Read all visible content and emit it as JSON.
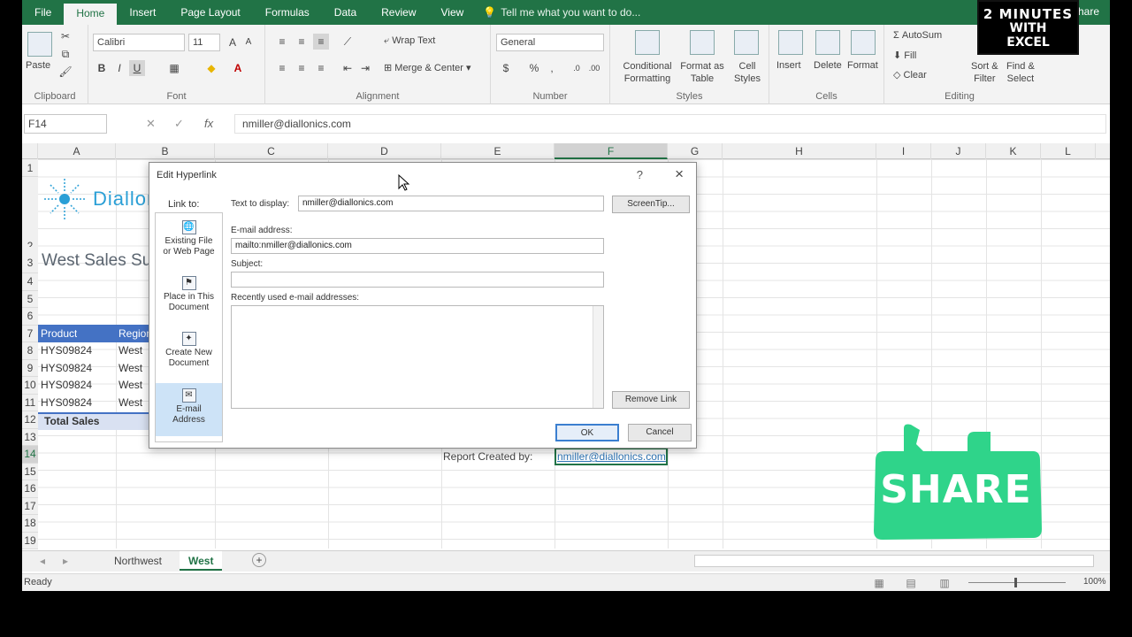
{
  "ribbon": {
    "tabs": [
      "File",
      "Home",
      "Insert",
      "Page Layout",
      "Formulas",
      "Data",
      "Review",
      "View"
    ],
    "active_tab": "Home",
    "tell_me": "Tell me what you want to do...",
    "share": "Share",
    "clipboard": {
      "paste": "Paste",
      "label": "Clipboard"
    },
    "font": {
      "name": "Calibri",
      "size": "11",
      "bold": "B",
      "italic": "I",
      "underline": "U",
      "label": "Font"
    },
    "alignment": {
      "wrap_text": "Wrap Text",
      "merge_center": "Merge & Center",
      "label": "Alignment"
    },
    "number": {
      "format": "General",
      "currency": "$",
      "percent": "%",
      "comma": ",",
      "label": "Number"
    },
    "styles": {
      "conditional": [
        "Conditional",
        "Formatting"
      ],
      "format_as": [
        "Format as",
        "Table"
      ],
      "cell_styles": [
        "Cell",
        "Styles"
      ],
      "label": "Styles"
    },
    "cells": {
      "insert": "Insert",
      "delete": "Delete",
      "format": "Format",
      "label": "Cells"
    },
    "editing": {
      "autosum": "AutoSum",
      "fill": "Fill",
      "clear": "Clear",
      "sort_filter": [
        "Sort &",
        "Filter"
      ],
      "find_select": [
        "Find &",
        "Select"
      ],
      "label": "Editing"
    }
  },
  "formula_bar": {
    "name_box": "F14",
    "fx": "fx",
    "content": "nmiller@diallonics.com"
  },
  "grid": {
    "columns": [
      "A",
      "B",
      "C",
      "D",
      "E",
      "F",
      "G",
      "H",
      "I",
      "J",
      "K",
      "L"
    ],
    "selected_column": "F",
    "rows": [
      "1",
      "2",
      "3",
      "4",
      "5",
      "6",
      "7",
      "8",
      "9",
      "10",
      "11",
      "12",
      "13",
      "14",
      "15",
      "16",
      "17",
      "18",
      "19"
    ],
    "selected_row": "14",
    "logo_text": "Diallonics",
    "sheet_title": "West Sales Summary",
    "header_product": "Product",
    "header_region": "Region",
    "data_rows": [
      {
        "product": "HYS09824",
        "region": "West"
      },
      {
        "product": "HYS09824",
        "region": "West"
      },
      {
        "product": "HYS09824",
        "region": "West"
      },
      {
        "product": "HYS09824",
        "region": "West"
      }
    ],
    "total_label": "Total Sales",
    "report_label": "Report Created by:",
    "report_value": "nmiller@diallonics.com"
  },
  "dialog": {
    "title": "Edit Hyperlink",
    "help": "?",
    "close": "×",
    "link_to": "Link to:",
    "link_options": [
      {
        "line1": "Existing File",
        "line2": "or Web Page"
      },
      {
        "line1": "Place in This",
        "line2": "Document"
      },
      {
        "line1": "Create New",
        "line2": "Document"
      },
      {
        "line1": "E-mail",
        "line2": "Address"
      }
    ],
    "text_to_display_label": "Text to display:",
    "text_to_display": "nmiller@diallonics.com",
    "screentip": "ScreenTip...",
    "email_label": "E-mail address:",
    "email": "mailto:nmiller@diallonics.com",
    "subject_label": "Subject:",
    "subject": "",
    "recent_label": "Recently used e-mail addresses:",
    "remove_link": "Remove Link",
    "ok": "OK",
    "cancel": "Cancel"
  },
  "sheets": {
    "tabs": [
      "Northwest",
      "West"
    ],
    "active": "West",
    "add": "+"
  },
  "status": {
    "ready": "Ready",
    "zoom": "100%"
  },
  "overlay": {
    "badge_line1": "2 MINUTES",
    "badge_line2": "WITH",
    "badge_line3": "EXCEL",
    "share_sticker": "SHARE"
  },
  "colors": {
    "excel_green": "#217346",
    "sticker_green": "#2fd48a",
    "accent_blue": "#3b7fd0"
  }
}
